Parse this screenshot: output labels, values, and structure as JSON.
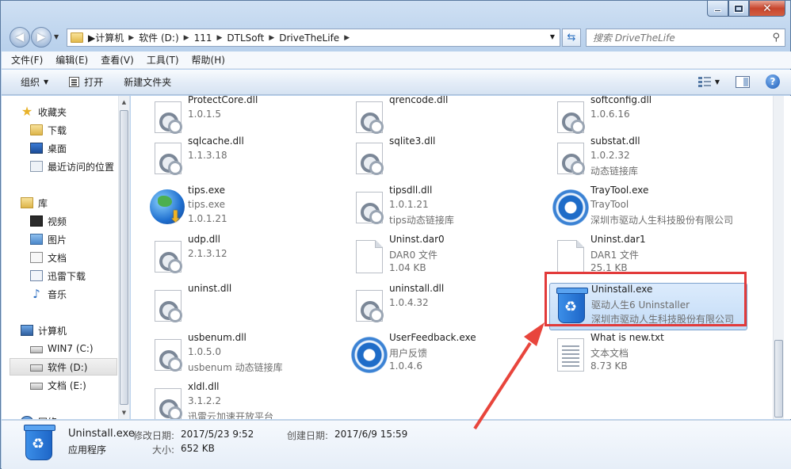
{
  "window": {
    "caption": {
      "minimize": "–",
      "maximize": "□",
      "close": "✕"
    }
  },
  "address_bar": {
    "crumbs": [
      "计算机",
      "软件 (D:)",
      "111",
      "DTLSoft",
      "DriveTheLife"
    ],
    "search_placeholder": "搜索 DriveTheLife"
  },
  "menu": [
    "文件(F)",
    "编辑(E)",
    "查看(V)",
    "工具(T)",
    "帮助(H)"
  ],
  "commands": {
    "organize": "组织",
    "open": "打开",
    "new_folder": "新建文件夹"
  },
  "nav": {
    "favorites": "收藏夹",
    "fav_items": [
      "下载",
      "桌面",
      "最近访问的位置"
    ],
    "libraries": "库",
    "lib_items": [
      "视频",
      "图片",
      "文档",
      "迅雷下载",
      "音乐"
    ],
    "computer": "计算机",
    "drives": [
      "WIN7 (C:)",
      "软件 (D:)",
      "文档 (E:)"
    ],
    "network": "网络"
  },
  "files": [
    {
      "name": "ProtectCore.dll",
      "l2": "1.0.1.5",
      "l3": "",
      "icon": "dll"
    },
    {
      "name": "qrencode.dll",
      "l2": "",
      "l3": "",
      "icon": "dll"
    },
    {
      "name": "softconfig.dll",
      "l2": "1.0.6.16",
      "l3": "",
      "icon": "dll"
    },
    {
      "name": "sqlcache.dll",
      "l2": "1.1.3.18",
      "l3": "",
      "icon": "dll"
    },
    {
      "name": "sqlite3.dll",
      "l2": "",
      "l3": "",
      "icon": "dll"
    },
    {
      "name": "substat.dll",
      "l2": "1.0.2.32",
      "l3": "动态链接库",
      "icon": "dll"
    },
    {
      "name": "tips.exe",
      "l2": "tips.exe",
      "l3": "1.0.1.21",
      "icon": "globe"
    },
    {
      "name": "tipsdll.dll",
      "l2": "1.0.1.21",
      "l3": "tips动态链接库",
      "icon": "dll"
    },
    {
      "name": "TrayTool.exe",
      "l2": "TrayTool",
      "l3": "深圳市驱动人生科技股份有限公司",
      "icon": "gear"
    },
    {
      "name": "udp.dll",
      "l2": "2.1.3.12",
      "l3": "",
      "icon": "dll"
    },
    {
      "name": "Uninst.dar0",
      "l2": "DAR0 文件",
      "l3": "1.04 KB",
      "icon": "blank"
    },
    {
      "name": "Uninst.dar1",
      "l2": "DAR1 文件",
      "l3": "25.1 KB",
      "icon": "blank"
    },
    {
      "name": "uninst.dll",
      "l2": "",
      "l3": "",
      "icon": "dll"
    },
    {
      "name": "uninstall.dll",
      "l2": "1.0.4.32",
      "l3": "",
      "icon": "dll"
    },
    {
      "name": "Uninstall.exe",
      "l2": "驱动人生6 Uninstaller",
      "l3": "深圳市驱动人生科技股份有限公司",
      "icon": "bin"
    },
    {
      "name": "usbenum.dll",
      "l2": "1.0.5.0",
      "l3": "usbenum 动态链接库",
      "icon": "dll"
    },
    {
      "name": "UserFeedback.exe",
      "l2": "用户反馈",
      "l3": "1.0.4.6",
      "icon": "gear"
    },
    {
      "name": "What is new.txt",
      "l2": "文本文档",
      "l3": "8.73 KB",
      "icon": "txt"
    },
    {
      "name": "xldl.dll",
      "l2": "3.1.2.2",
      "l3": "迅雷云加速开放平台",
      "icon": "dll"
    }
  ],
  "selected_file": "Uninstall.exe",
  "details": {
    "name": "Uninstall.exe",
    "type": "应用程序",
    "modified_label": "修改日期:",
    "modified": "2017/5/23 9:52",
    "created_label": "创建日期:",
    "created": "2017/6/9 15:59",
    "size_label": "大小:",
    "size": "652 KB"
  },
  "colors": {
    "highlight_box": "#e23a3a",
    "arrow": "#e8453c",
    "selection": "#cfe3fa"
  }
}
